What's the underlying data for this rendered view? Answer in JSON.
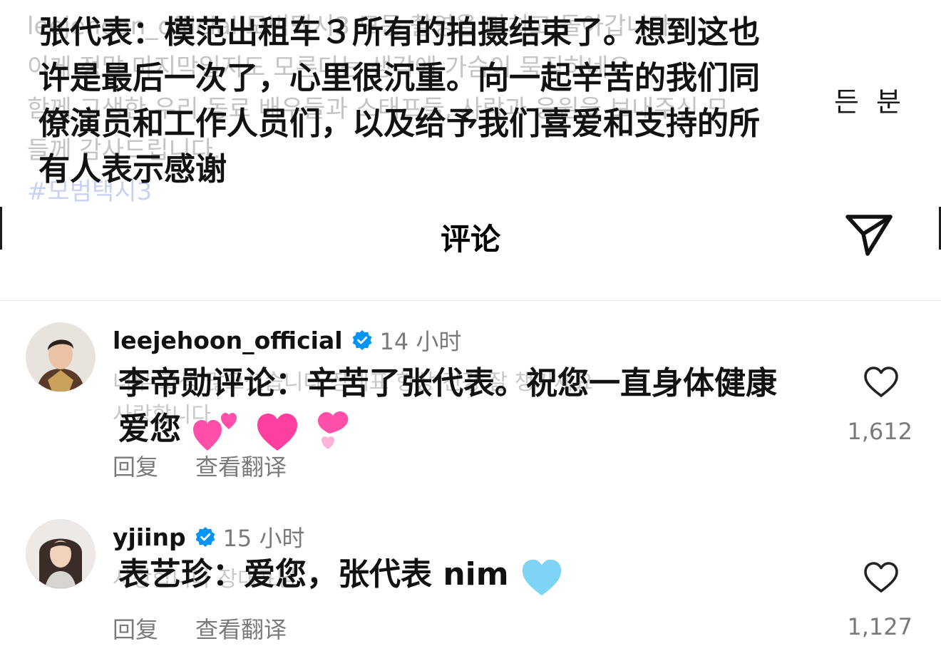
{
  "caption": {
    "original_faded_lines": [
      "leejehoon_official 모범택시3 모든 촬영을 마치고 돌아갑니다",
      "이게 정말 마지막일지도 모른다는 생각에 가슴이 묵직하네요",
      "함께 고생한 우리 동료 배우들과 스태프들, 사랑과 응원을 보내주신 모",
      "들께 감사드립니다.",
      "#모범택시3"
    ],
    "original_extra": "든 분",
    "subtitle_lines": [
      "张代表：模范出租车３所有的拍摄结束了。想到这也",
      "许是最后一次了，心里很沉重。向一起辛苦的我们同",
      "僚演员和工作人员们，以及给予我们喜爱和支持的所",
      "有人表示感谢"
    ]
  },
  "header": {
    "title": "评论",
    "share_icon": "paper-plane-icon"
  },
  "comments": [
    {
      "username": "leejehoon_official",
      "verified": true,
      "time": "14 小时",
      "original_faded_lines": [
        "너무 고생 많으셨습니다 장대표 항상 건강 잘 챙기세요",
        "사랑합니다"
      ],
      "text_lines": [
        "李帝勋评论：辛苦了张代表。祝您一直身体健康",
        "爱您"
      ],
      "emoji": [
        "two-hearts",
        "pink-heart",
        "heart-exclamation"
      ],
      "reply_label": "回复",
      "translate_label": "查看翻译",
      "likes": "1,612"
    },
    {
      "username": "yjiinp",
      "verified": true,
      "time": "15 小时",
      "original_faded_lines": [
        "사랑합니다 장대표님"
      ],
      "text_lines": [
        "表艺珍：爱您，张代表 nim"
      ],
      "emoji": [
        "light-blue-heart"
      ],
      "reply_label": "回复",
      "translate_label": "查看翻译",
      "likes": "1,127"
    }
  ],
  "colors": {
    "text": "#111111",
    "secondary": "#7a7a7a",
    "faded": "#c9c9c9",
    "verified": "#0095f6",
    "heart_pink": "#ff3fa0",
    "heart_blue": "#7fd3f5"
  }
}
